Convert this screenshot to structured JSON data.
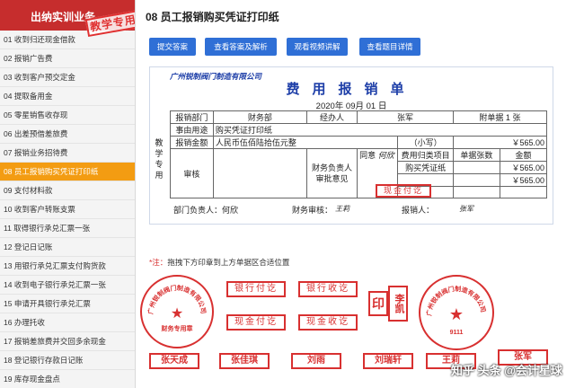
{
  "sidebar": {
    "title": "出纳实训业务",
    "stamp": "教学专用",
    "items": [
      "01 收到归还现金借款",
      "02 报销广告费",
      "03 收到客户预交定金",
      "04 提取备用金",
      "05 零星销售收存现",
      "06 出差预借差旅费",
      "07 报销业务招待费",
      "08 员工报销购买凭证打印纸",
      "09 支付材料款",
      "10 收到客户转账支票",
      "11 取得银行承兑汇票一张",
      "12 登记日记账",
      "13 用银行承兑汇票支付购货款",
      "14 收到电子银行承兑汇票一张",
      "15 申请开具银行承兑汇票",
      "16 办理托收",
      "17 报销差旅费并交回多余现金",
      "18 登记银行存款日记账",
      "19 库存现金盘点"
    ],
    "active_index": 7
  },
  "main": {
    "title": "08 员工报销购买凭证打印纸",
    "buttons": [
      "提交答案",
      "查看答案及解析",
      "观看视频讲解",
      "查看题目详情"
    ]
  },
  "voucher": {
    "company": "广州锐制阀门制造有限公司",
    "heading": "费用报销单",
    "date": "2020年 09月 01 日",
    "teaching_label": "教学专用",
    "dept_label": "报销部门",
    "dept": "财务部",
    "handler_label": "经办人",
    "handler": "张军",
    "attach_label": "附单据",
    "attach_count": "1",
    "attach_unit": "张",
    "purpose_label": "事由用途",
    "purpose": "购买凭证打印纸",
    "amount_label": "报销金额",
    "amount_words": "人民币伍佰陆拾伍元整",
    "amount_small_label": "（小写）",
    "amount_num": "￥565.00",
    "review_label": "审核",
    "finance_opinion_label": "财务负责人审批意见",
    "agree": "同意",
    "agree_name": "何欣",
    "approve_stamp": "现金付讫",
    "category_label": "费用归类项目",
    "doc_count_label": "单据张数",
    "amount_col_label": "金额",
    "category_value": "购买凭证纸",
    "category_amount": "￥565.00",
    "total_amount": "￥565.00",
    "dept_head": "部门负责人：何欣",
    "finance_review": "财务审核：",
    "finance_reviewer": "王莉",
    "payee_label": "报销人：",
    "payee": "张军"
  },
  "stamps": {
    "note_star": "*注：",
    "note": "拖拽下方印章到上方单据区合适位置",
    "round1_top": "广州锐制阀门制造有限公司",
    "round1_bottom": "财务专用章",
    "bank_paid": "银行付讫",
    "bank_received": "银行收讫",
    "cash_paid": "现金付讫",
    "cash_received": "现金收讫",
    "seal_left": "印",
    "seal_right": "李凯",
    "round2_top": "广州锐制阀门制造有限公司",
    "round2_code": "9111",
    "names": [
      "张天成",
      "张佳琪",
      "刘雨",
      "刘瑞轩",
      "王莉",
      "张军"
    ],
    "watermark": "知乎 头条 @会计星球"
  },
  "colors": {
    "sidebar_header": "#c62d2d",
    "active_item": "#f39c12",
    "button": "#2f6fd6",
    "stamp_red": "#d83030",
    "voucher_blue": "#1e3fa8"
  }
}
